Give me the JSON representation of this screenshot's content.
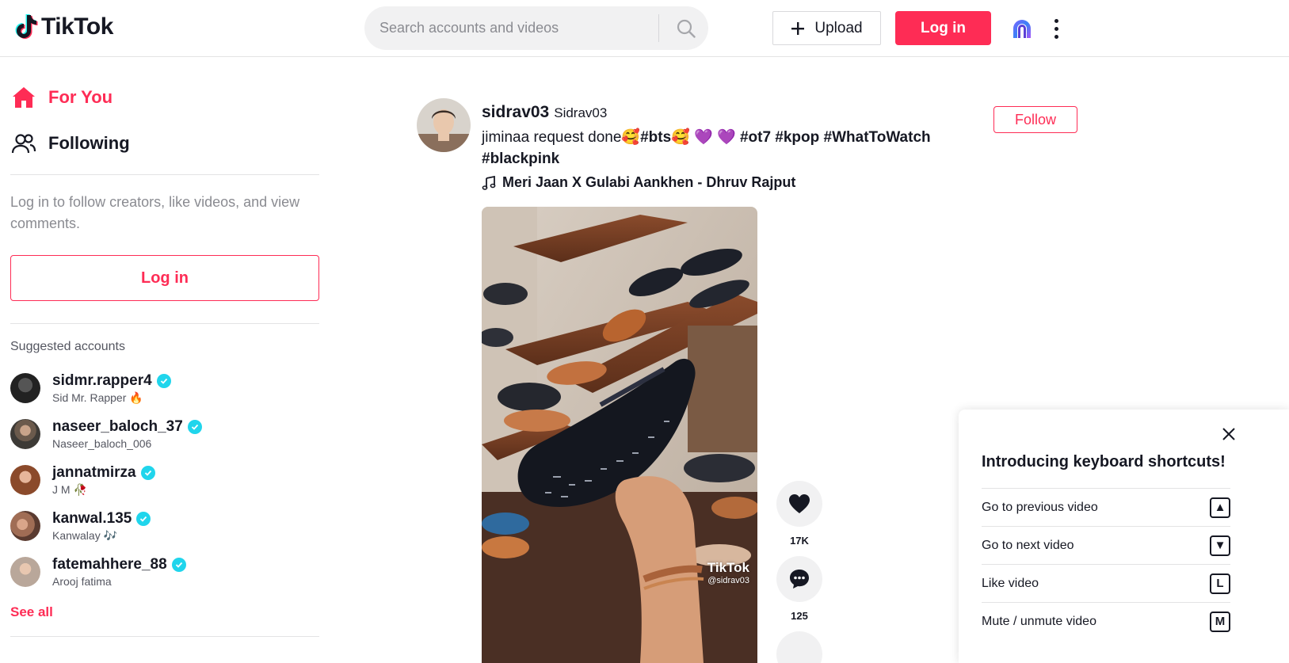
{
  "header": {
    "logo_text": "TikTok",
    "search_placeholder": "Search accounts and videos",
    "upload_label": "Upload",
    "login_label": "Log in"
  },
  "sidebar": {
    "nav": [
      {
        "label": "For You",
        "icon": "home-icon",
        "active": true
      },
      {
        "label": "Following",
        "icon": "following-users-icon",
        "active": false
      }
    ],
    "login_hint": "Log in to follow creators, like videos, and view comments.",
    "login_label": "Log in",
    "suggested_title": "Suggested accounts",
    "accounts": [
      {
        "username": "sidmr.rapper4",
        "display": "Sid Mr. Rapper 🔥",
        "verified": true
      },
      {
        "username": "naseer_baloch_37",
        "display": "Naseer_baloch_006",
        "verified": true
      },
      {
        "username": "jannatmirza",
        "display": "J M 🥀",
        "verified": true
      },
      {
        "username": "kanwal.135",
        "display": "Kanwalay 🎶",
        "verified": true
      },
      {
        "username": "fatemahhere_88",
        "display": "Arooj fatima",
        "verified": true
      }
    ],
    "see_all": "See all"
  },
  "post": {
    "username": "sidrav03",
    "display_name": "Sidrav03",
    "caption_text": "jiminaa request done🥰",
    "caption_tags_1": "#bts",
    "caption_mid": "🥰 💜 💜 ",
    "caption_tags_2": "#ot7 #kpop #WhatToWatch",
    "caption_tags_3": "#blackpink",
    "music": "Meri Jaan X Gulabi Aankhen - Dhruv Rajput",
    "follow_label": "Follow",
    "watermark_logo": "TikTok",
    "watermark_user": "@sidrav03",
    "likes": "17K",
    "comments": "125"
  },
  "shortcuts": {
    "title": "Introducing keyboard shortcuts!",
    "items": [
      {
        "label": "Go to previous video",
        "key": "▲"
      },
      {
        "label": "Go to next video",
        "key": "▼"
      },
      {
        "label": "Like video",
        "key": "L"
      },
      {
        "label": "Mute / unmute video",
        "key": "M"
      }
    ]
  },
  "colors": {
    "brand": "#fe2c55",
    "verified": "#20d5ec"
  }
}
